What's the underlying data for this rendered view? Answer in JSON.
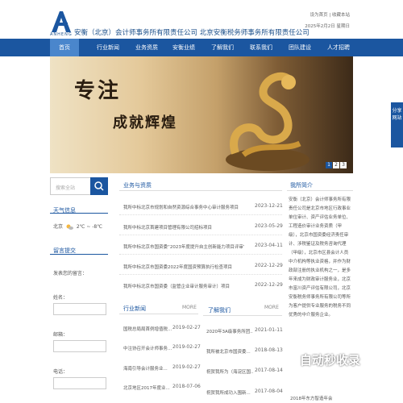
{
  "header": {
    "logo_sub": "ANHENG",
    "company": "安衡（北京）会计师事务所有限责任公司 北京安衡税务师事务所有限责任公司",
    "top_links": "设为首页 | 收藏本站",
    "date": "2025年2月2日 星期日"
  },
  "nav": [
    "首页",
    "行业新闻",
    "业务资质",
    "安衡业绩",
    "了解我们",
    "联系我们",
    "团队建设",
    "人才招聘"
  ],
  "banner": {
    "line1": "专注",
    "line2": "成就辉煌",
    "dots": [
      "1",
      "2",
      "3"
    ]
  },
  "share": "分享网站",
  "search": {
    "placeholder": "搜索全站"
  },
  "weather": {
    "title": "天气信息",
    "city": "北京",
    "temp": "2℃ ~ -8℃"
  },
  "message": {
    "title": "留言提交",
    "label_content": "发表您的留言：",
    "label_name": "姓名：",
    "label_email": "邮箱：",
    "label_phone": "电话："
  },
  "business": {
    "title": "业务与资质",
    "items": [
      {
        "text": "我所中标北京市规划和自然资源综合事务中心审计服务项目",
        "date": "2023-12-21"
      },
      {
        "text": "我所中标北京首建项目管理有限公司招标项目",
        "date": "2023-05-29"
      },
      {
        "text": "我所中标北京市国资委“2023年度提升自主创新能力项目评审”",
        "date": "2023-04-11"
      },
      {
        "text": "我所中标北京市国资委2022年度国资预算执行检查项目",
        "date": "2022-12-29"
      },
      {
        "text": "我所中标北京市国资委（监管企业审计服务审计）项目",
        "date": "2022-12-29"
      }
    ]
  },
  "intro": {
    "title": "我所简介",
    "text": "安衡（北京）会计师事务所有限责任公司是北京市地区行政事业单位审计、资产评估业务单位、工程造价审计业务资质（甲级），北京市国资委经济责任审计、涉税鉴证及税务咨询代理（甲级），北京市区县会计人员中介机构等执业资格，并作为财政部注册的执业机构之一，是多年来成为财政审计服务业，北京市富川资产评估有限公司，北京安衡税务师事务所有限公司等所为客户提供专业服务的税务不同优秀的中介服务企业。"
  },
  "industry": {
    "title": "行业新闻",
    "more": "MORE",
    "items": [
      {
        "text": "国税总局局首例增值税...",
        "date": "2019-02-27"
      },
      {
        "text": "中注协召开会计师事务...",
        "date": "2019-02-27"
      },
      {
        "text": "海南引导会计服务业...",
        "date": "2019-02-27"
      },
      {
        "text": "北京地区2017年度业...",
        "date": "2018-07-06"
      }
    ]
  },
  "about": {
    "title": "了解我们",
    "more": "MORE",
    "items": [
      {
        "text": "2020年3A级事务所团...",
        "date": "2021-01-11"
      },
      {
        "text": "我所被北京市国资委...",
        "date": "2018-08-13"
      },
      {
        "text": "祝贺我所为（海淀区国...",
        "date": "2017-08-14"
      },
      {
        "text": "祝贺我所成功入围新...",
        "date": "2017-08-04"
      }
    ],
    "more_item": "2018年东方智造年会"
  },
  "more_label": "MORE",
  "watermark": "自动秒收录"
}
